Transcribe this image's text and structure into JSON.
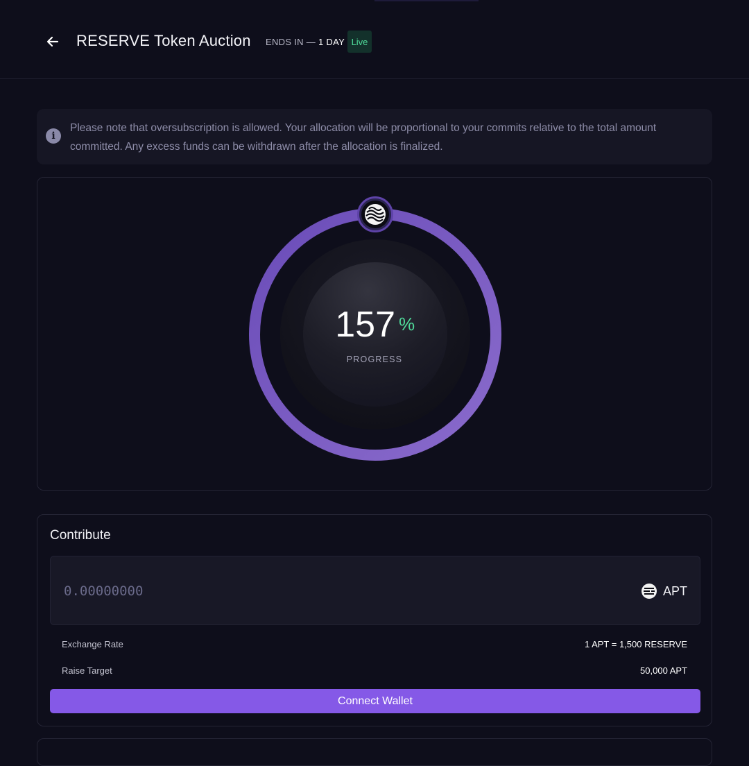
{
  "header": {
    "title": "RESERVE Token Auction",
    "ends_in_label": "ENDS IN —",
    "ends_in_value": "1 DAY",
    "status_badge": "Live"
  },
  "info_note": {
    "text": "Please note that oversubscription is allowed. Your allocation will be proportional to your commits relative to the total amount committed. Any excess funds can be withdrawn after the allocation is finalized."
  },
  "progress": {
    "value": "157",
    "unit": "%",
    "label": "PROGRESS",
    "ring_fill_fraction": 1.0,
    "token_icon": "reserve-token-icon"
  },
  "contribute": {
    "title": "Contribute",
    "amount_placeholder": "0.00000000",
    "currency": "APT",
    "currency_icon": "apt-icon",
    "exchange_rate_label": "Exchange Rate",
    "exchange_rate_value": "1 APT = 1,500 RESERVE",
    "raise_target_label": "Raise Target",
    "raise_target_value": "50,000 APT",
    "connect_button": "Connect Wallet"
  },
  "colors": {
    "background": "#0e0e1b",
    "accent": "#8559e7",
    "ring": "#7a5bc4",
    "success": "#4fdb9a",
    "muted_text": "#8e8da9"
  }
}
